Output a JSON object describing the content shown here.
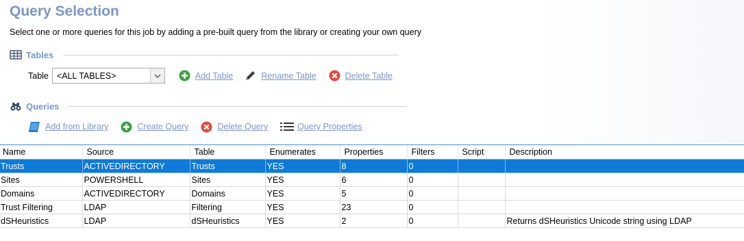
{
  "page": {
    "title": "Query Selection",
    "subtitle": "Select one or more queries for this job by adding a pre-built query from the library or creating your own query"
  },
  "tables_section": {
    "heading": "Tables",
    "table_label": "Table",
    "table_select_value": "<ALL TABLES>",
    "add_table": "Add Table",
    "rename_table": "Rename Table",
    "delete_table": "Delete Table"
  },
  "queries_section": {
    "heading": "Queries",
    "add_from_library": "Add from Library",
    "create_query": "Create Query",
    "delete_query": "Delete Query",
    "query_properties": "Query Properties"
  },
  "grid": {
    "columns": [
      "Name",
      "Source",
      "Table",
      "Enumerates",
      "Properties",
      "Filters",
      "Script",
      "Description"
    ],
    "rows": [
      [
        "Trusts",
        "ACTIVEDIRECTORY",
        "Trusts",
        "YES",
        "8",
        "0",
        "",
        ""
      ],
      [
        "Sites",
        "POWERSHELL",
        "Sites",
        "YES",
        "6",
        "0",
        "",
        ""
      ],
      [
        "Domains",
        "ACTIVEDIRECTORY",
        "Domains",
        "YES",
        "5",
        "0",
        "",
        ""
      ],
      [
        "Trust Filtering",
        "LDAP",
        "Filtering",
        "YES",
        "23",
        "0",
        "",
        ""
      ],
      [
        "dSHeuristics",
        "LDAP",
        "dSHeuristics",
        "YES",
        "2",
        "0",
        "",
        "Returns dSHeuristics Unicode string using LDAP"
      ]
    ],
    "selected_row": 0
  },
  "colors": {
    "accent": "#7b96c9",
    "selection": "#0f7ad7",
    "add_green": "#3aa142",
    "delete_red": "#e5483c"
  },
  "icons": {
    "tables": "table-grid-icon",
    "queries": "binoculars-icon",
    "add": "plus-circle-icon",
    "rename": "pencil-icon",
    "delete": "x-circle-icon",
    "library": "book-icon",
    "properties": "list-icon",
    "dropdown": "chevron-down-icon"
  }
}
